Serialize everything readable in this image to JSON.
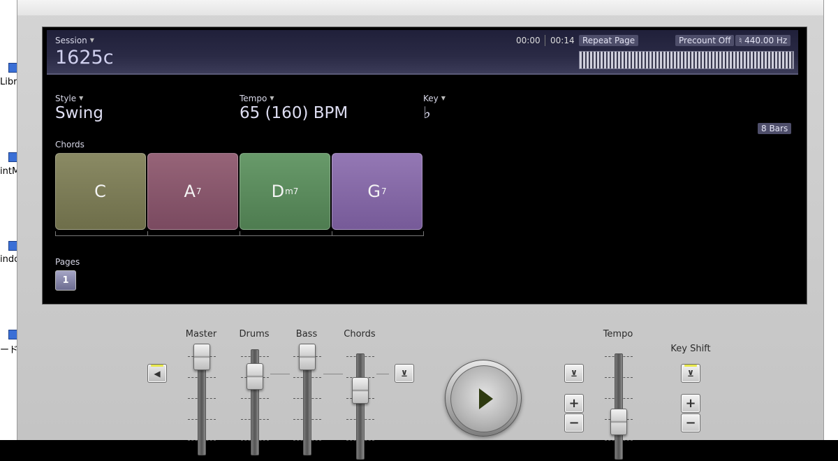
{
  "desktop": {
    "labels": [
      "Libre",
      "intM",
      "indo",
      "ードウ"
    ]
  },
  "session": {
    "label": "Session",
    "name": "1625c",
    "time_elapsed": "00:00",
    "time_total": "00:14",
    "repeat": "Repeat Page",
    "precount": "Precount Off",
    "tuning": "♮ 440.00 Hz"
  },
  "style": {
    "label": "Style",
    "value": "Swing"
  },
  "tempo": {
    "label": "Tempo",
    "value": "65 (160) BPM"
  },
  "key": {
    "label": "Key",
    "value": "♭"
  },
  "bars": "8 Bars",
  "chords": {
    "label": "Chords",
    "items": [
      {
        "root": "C",
        "quality": "",
        "color": "#80805a"
      },
      {
        "root": "A",
        "quality": "7",
        "color": "#8c5a70"
      },
      {
        "root": "D",
        "quality": "m7",
        "color": "#5e8e60"
      },
      {
        "root": "G",
        "quality": "7",
        "color": "#8a6aa8"
      }
    ]
  },
  "pages": {
    "label": "Pages",
    "items": [
      "1"
    ]
  },
  "mixer": {
    "master": "Master",
    "drums": "Drums",
    "bass": "Bass",
    "chords": "Chords",
    "tempo": "Tempo",
    "key_shift": "Key Shift",
    "plus": "+",
    "minus": "−"
  }
}
